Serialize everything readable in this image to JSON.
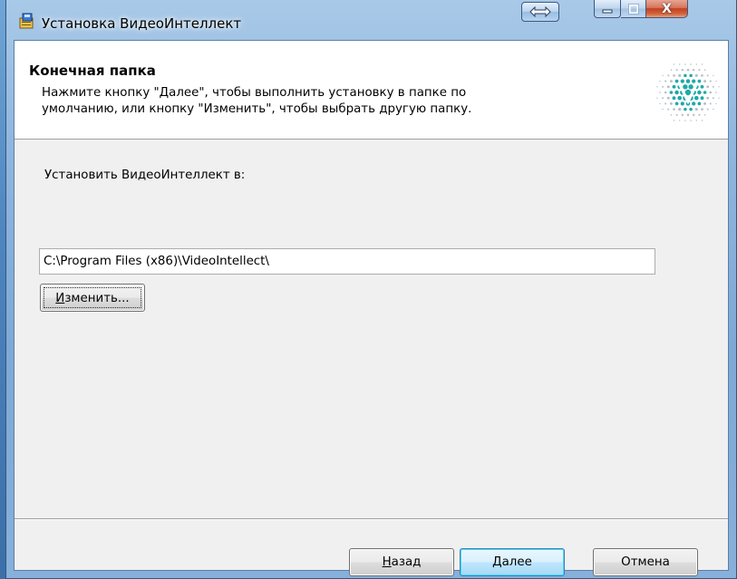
{
  "window": {
    "title": "Установка ВидеоИнтеллект",
    "close_glyph": "X",
    "resize_glyph": "⟺"
  },
  "banner": {
    "title": "Конечная папка",
    "description_line1": "Нажмите кнопку \"Далее\", чтобы выполнить установку в папке по",
    "description_line2": "умолчанию, или кнопку \"Изменить\", чтобы выбрать другую папку."
  },
  "main": {
    "install_label": "Установить ВидеоИнтеллект в:",
    "path_value": "C:\\Program Files (x86)\\VideoIntellect\\",
    "change_button_accel": "И",
    "change_button_rest": "зменить..."
  },
  "footer": {
    "back_accel": "Н",
    "back_rest": "азад",
    "next_label": "Далее",
    "cancel_label": "Отмена"
  },
  "colors": {
    "logo_teal": "#1fa9a7",
    "logo_gray": "#b9bfc4",
    "close_red": "#c24020"
  }
}
